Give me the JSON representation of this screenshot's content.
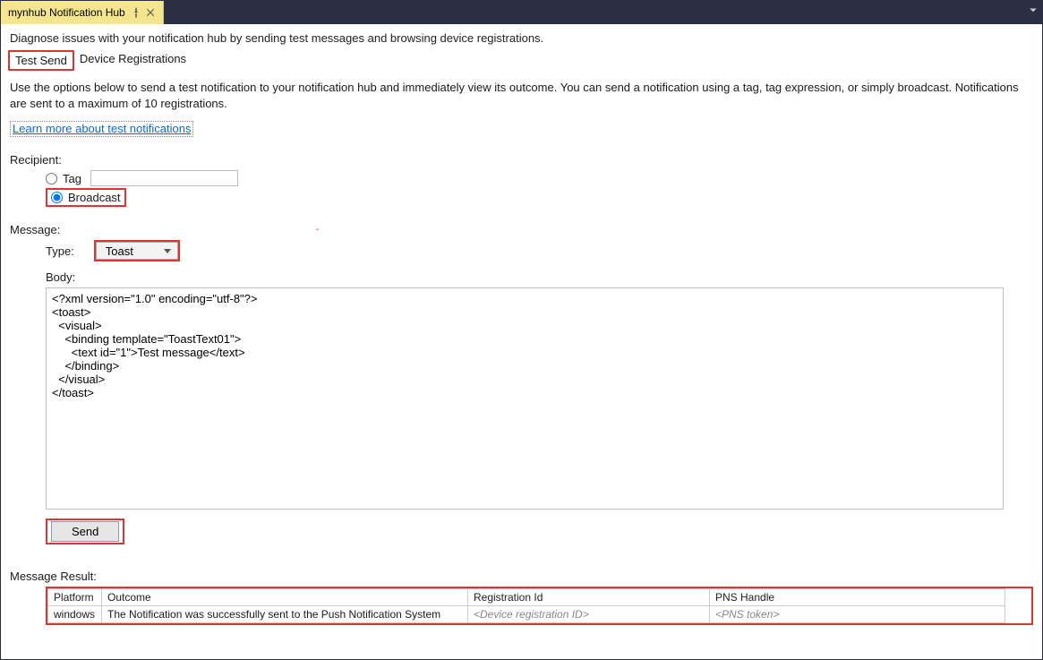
{
  "titlebar": {
    "tab_label": "mynhub Notification Hub"
  },
  "intro": "Diagnose issues with your notification hub by sending test messages and browsing device registrations.",
  "subtabs": {
    "test_send": "Test Send",
    "device_registrations": "Device Registrations"
  },
  "description": "Use the options below to send a test notification to your notification hub and immediately view its outcome. You can send a notification using a tag, tag expression, or simply broadcast. Notifications are sent to a maximum of 10 registrations.",
  "learn_more": "Learn more about test notifications",
  "recipient": {
    "label": "Recipient:",
    "tag_label": "Tag",
    "broadcast_label": "Broadcast",
    "selected": "broadcast",
    "tag_value": ""
  },
  "message": {
    "label": "Message:",
    "type_label": "Type:",
    "type_value": "Toast",
    "body_label": "Body:",
    "body_value": "<?xml version=\"1.0\" encoding=\"utf-8\"?>\n<toast>\n  <visual>\n    <binding template=\"ToastText01\">\n      <text id=\"1\">Test message</text>\n    </binding>\n  </visual>\n</toast>"
  },
  "send_label": "Send",
  "result": {
    "label": "Message Result:",
    "headers": {
      "platform": "Platform",
      "outcome": "Outcome",
      "reg": "Registration Id",
      "pns": "PNS Handle"
    },
    "rows": [
      {
        "platform": "windows",
        "outcome": "The Notification was successfully sent to the Push Notification System",
        "reg": "<Device registration ID>",
        "pns": "<PNS token>"
      }
    ]
  }
}
